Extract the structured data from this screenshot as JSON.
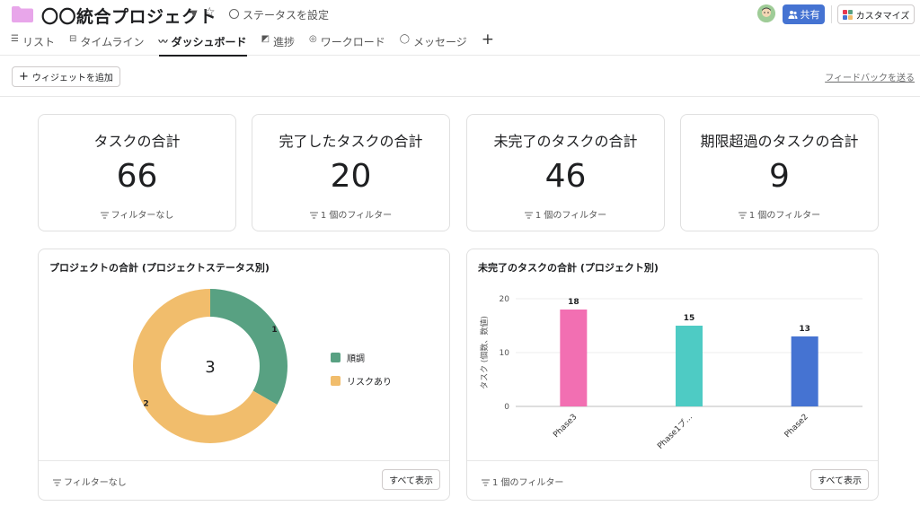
{
  "header": {
    "project_title": "〇〇統合プロジェクト",
    "status_label": "ステータスを設定",
    "share_label": "共有",
    "customize_label": "カスタマイズ",
    "folder_color": "#e8a6ea"
  },
  "tabs": [
    {
      "label": "リスト",
      "icon": "list-icon"
    },
    {
      "label": "タイムライン",
      "icon": "timeline-icon"
    },
    {
      "label": "ダッシュボード",
      "icon": "dashboard-icon",
      "active": true
    },
    {
      "label": "進捗",
      "icon": "progress-icon"
    },
    {
      "label": "ワークロード",
      "icon": "workload-icon"
    },
    {
      "label": "メッセージ",
      "icon": "message-icon"
    }
  ],
  "toolbar": {
    "add_widget_label": "ウィジェットを追加",
    "feedback_label": "フィードバックを送る"
  },
  "stats": [
    {
      "title": "タスクの合計",
      "value": "66",
      "filter": "フィルターなし"
    },
    {
      "title": "完了したタスクの合計",
      "value": "20",
      "filter": "1 個のフィルター"
    },
    {
      "title": "未完了のタスクの合計",
      "value": "46",
      "filter": "1 個のフィルター"
    },
    {
      "title": "期限超過のタスクの合計",
      "value": "9",
      "filter": "1 個のフィルター"
    }
  ],
  "donut_card": {
    "title": "プロジェクトの合計 (プロジェクトステータス別)",
    "filter": "フィルターなし",
    "show_all": "すべて表示"
  },
  "bar_card": {
    "title": "未完了のタスクの合計 (プロジェクト別)",
    "filter": "1 個のフィルター",
    "show_all": "すべて表示"
  },
  "chart_data": [
    {
      "type": "pie",
      "title": "プロジェクトの合計 (プロジェクトステータス別)",
      "center_label": "3",
      "series": [
        {
          "name": "順調",
          "value": 1,
          "color": "#58a182"
        },
        {
          "name": "リスクあり",
          "value": 2,
          "color": "#f1bd6c"
        }
      ],
      "legend_position": "right"
    },
    {
      "type": "bar",
      "title": "未完了のタスクの合計 (プロジェクト別)",
      "ylabel": "タスク (個数、数値)",
      "ylim": [
        0,
        20
      ],
      "yticks": [
        0,
        10,
        20
      ],
      "categories": [
        "Phase3",
        "Phase1プ…",
        "Phase2"
      ],
      "values": [
        18,
        15,
        13
      ],
      "colors": [
        "#f26fb2",
        "#4ecbc4",
        "#4573d2"
      ],
      "grid": true
    }
  ]
}
